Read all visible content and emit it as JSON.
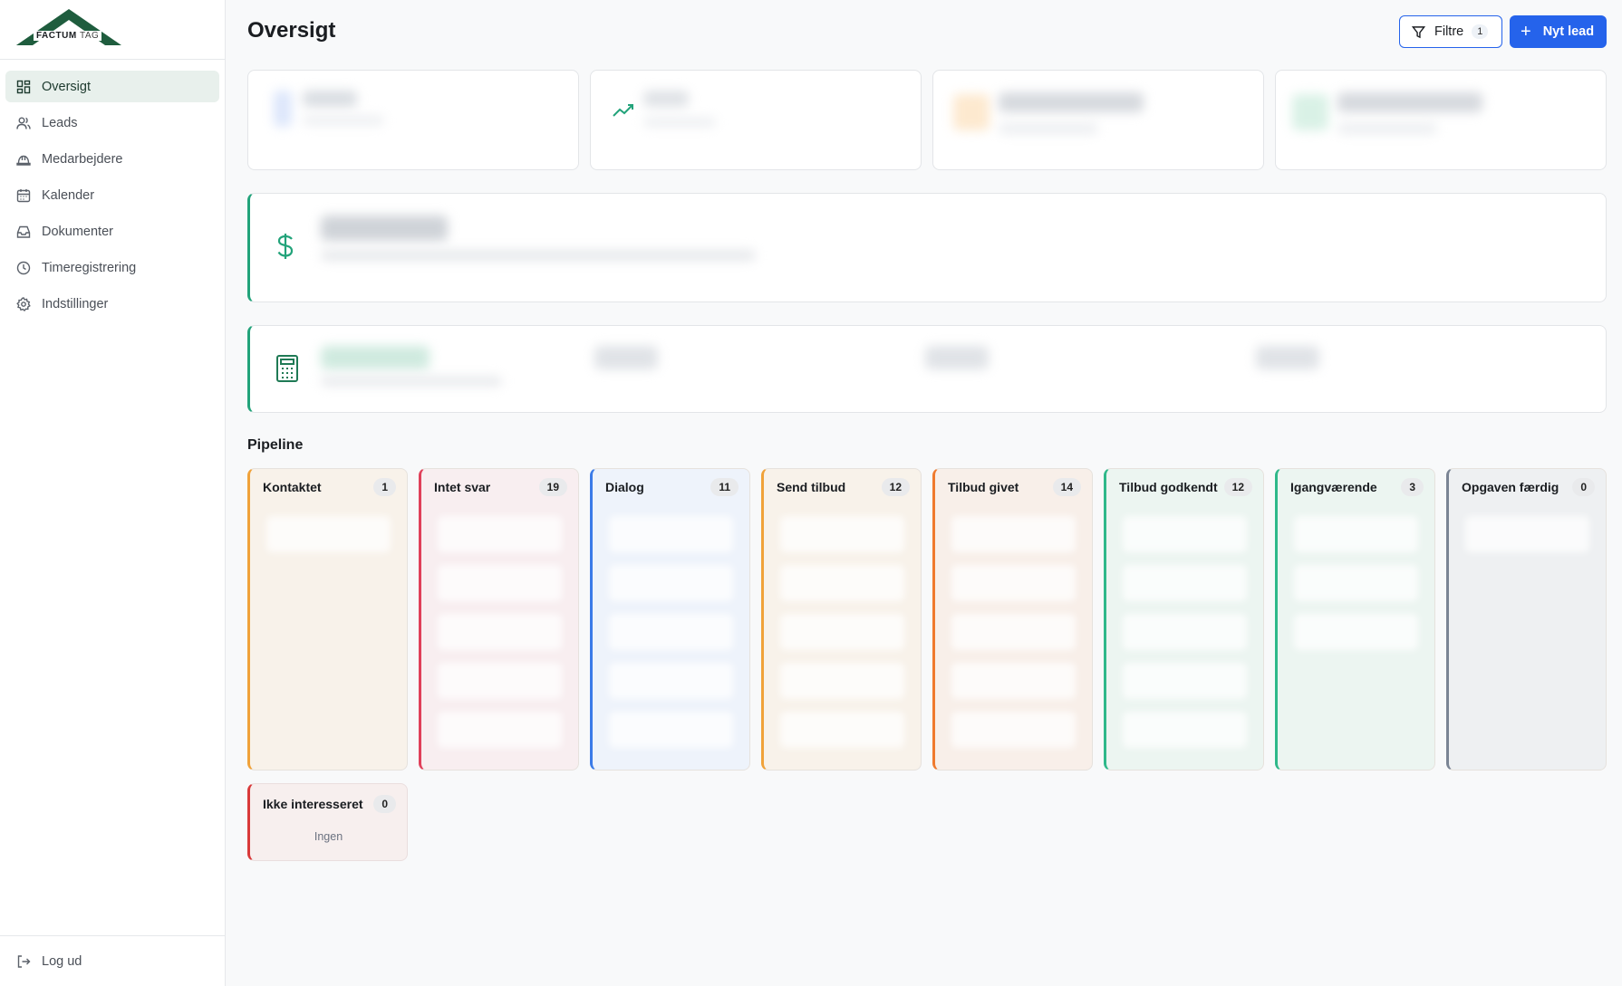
{
  "brand": {
    "name_bold": "FACTUM",
    "name_light": "TAG",
    "color": "#1f5d3e"
  },
  "sidebar": {
    "items": [
      {
        "label": "Oversigt",
        "icon": "dashboard-icon",
        "active": true
      },
      {
        "label": "Leads",
        "icon": "users-icon"
      },
      {
        "label": "Medarbejdere",
        "icon": "hard-hat-icon"
      },
      {
        "label": "Kalender",
        "icon": "calendar-icon"
      },
      {
        "label": "Dokumenter",
        "icon": "inbox-icon"
      },
      {
        "label": "Timeregistrering",
        "icon": "clock-icon"
      },
      {
        "label": "Indstillinger",
        "icon": "gear-icon"
      }
    ],
    "logout": {
      "label": "Log ud",
      "icon": "logout-icon"
    }
  },
  "header": {
    "title": "Oversigt",
    "filter_label": "Filtre",
    "filter_count": "1",
    "new_lead_label": "Nyt lead",
    "accent": "#2563eb"
  },
  "pipeline": {
    "title": "Pipeline",
    "columns": [
      {
        "label": "Kontaktet",
        "count": "1",
        "color": "#f0a23a",
        "bg": "#f8f2ea"
      },
      {
        "label": "Intet svar",
        "count": "19",
        "color": "#e0405a",
        "bg": "#f8eef0"
      },
      {
        "label": "Dialog",
        "count": "11",
        "color": "#3b7be8",
        "bg": "#eef3fb"
      },
      {
        "label": "Send tilbud",
        "count": "12",
        "color": "#f0a23a",
        "bg": "#f8f2ea"
      },
      {
        "label": "Tilbud givet",
        "count": "14",
        "color": "#ef7a2e",
        "bg": "#f8efe9"
      },
      {
        "label": "Tilbud godkendt",
        "count": "12",
        "color": "#2fb88a",
        "bg": "#ecf5f1"
      },
      {
        "label": "Igangværende",
        "count": "3",
        "color": "#2fb88a",
        "bg": "#ecf5f1"
      },
      {
        "label": "Opgaven færdig",
        "count": "0",
        "color": "#7a8494",
        "bg": "#eef0f2"
      }
    ],
    "extra": {
      "label": "Ikke interesseret",
      "count": "0",
      "empty_text": "Ingen",
      "color": "#d93a3a"
    }
  }
}
